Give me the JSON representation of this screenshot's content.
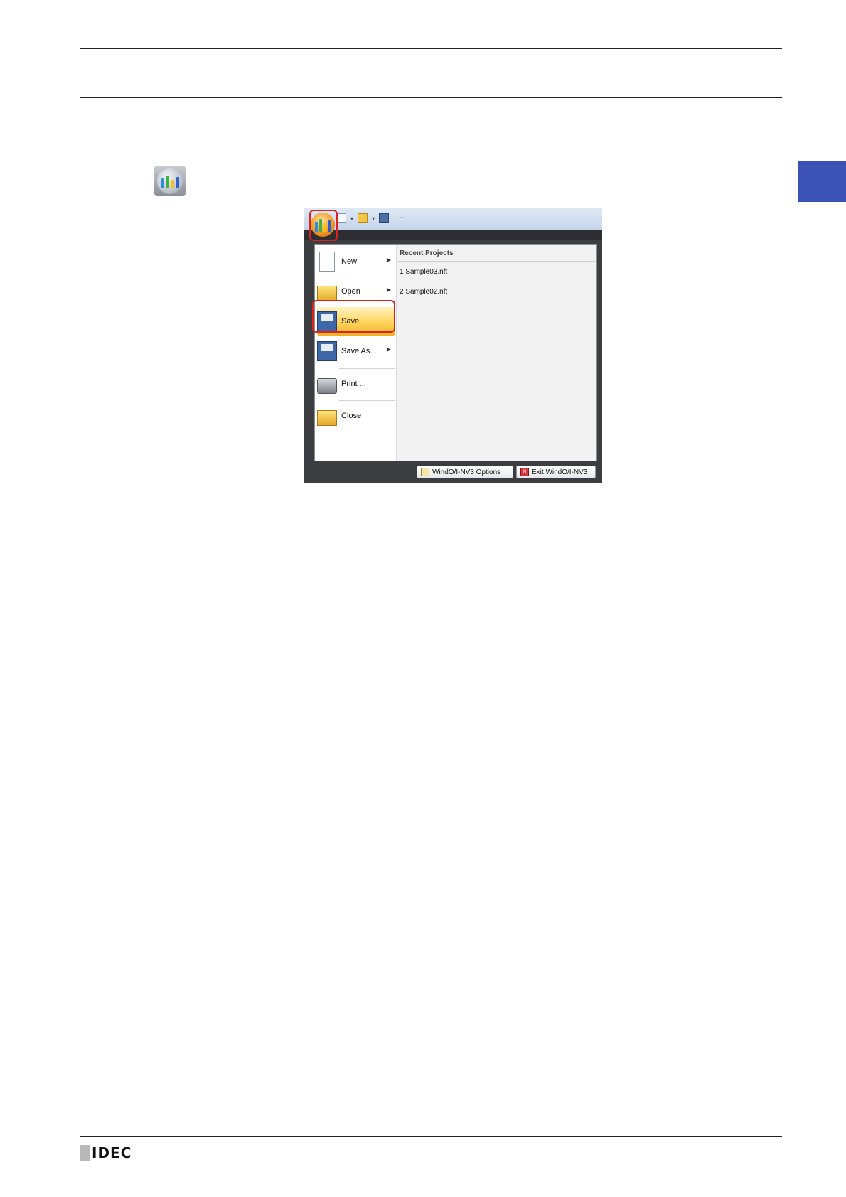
{
  "menu": {
    "items": [
      {
        "label": "New",
        "has_submenu": true
      },
      {
        "label": "Open",
        "has_submenu": true
      },
      {
        "label": "Save",
        "has_submenu": false
      },
      {
        "label": "Save As...",
        "has_submenu": true
      },
      {
        "label": "Print ...",
        "has_submenu": false
      },
      {
        "label": "Close",
        "has_submenu": false
      }
    ],
    "recent_title": "Recent Projects",
    "recent": [
      "1 Sample03.nft",
      "2 Sample02.nft"
    ],
    "options_button": "WindO/I-NV3 Options",
    "exit_button": "Exit WindO/I-NV3"
  },
  "footer": {
    "logo": "IDEC"
  },
  "colors": {
    "side_tab": "#3a52b3",
    "highlight": "#dd2222"
  },
  "icons": [
    "app-button-icon",
    "new-icon",
    "open-icon",
    "save-icon",
    "save-as-icon",
    "print-icon",
    "close-icon"
  ]
}
